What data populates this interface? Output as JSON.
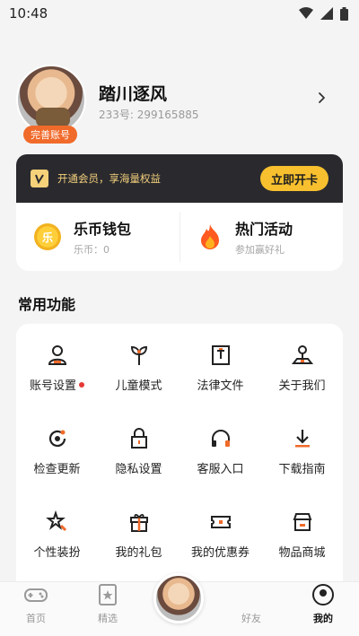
{
  "status_bar": {
    "time": "10:48"
  },
  "profile": {
    "name": "踏川逐风",
    "id_text": "233号: 299165885",
    "badge": "完善账号"
  },
  "vip": {
    "text": "开通会员，享海量权益",
    "button": "立即开卡"
  },
  "wallet": {
    "title": "乐币钱包",
    "sub": "乐币：0",
    "icon_text": "乐"
  },
  "events": {
    "title": "热门活动",
    "sub": "参加赢好礼"
  },
  "functions": {
    "title": "常用功能",
    "items": [
      {
        "label": "账号设置",
        "icon": "user-settings-icon"
      },
      {
        "label": "儿童模式",
        "icon": "sprout-icon"
      },
      {
        "label": "法律文件",
        "icon": "document-icon"
      },
      {
        "label": "关于我们",
        "icon": "about-icon"
      },
      {
        "label": "检查更新",
        "icon": "refresh-icon"
      },
      {
        "label": "隐私设置",
        "icon": "lock-icon"
      },
      {
        "label": "客服入口",
        "icon": "headset-icon"
      },
      {
        "label": "下载指南",
        "icon": "download-icon"
      },
      {
        "label": "个性装扮",
        "icon": "star-icon"
      },
      {
        "label": "我的礼包",
        "icon": "gift-icon"
      },
      {
        "label": "我的优惠券",
        "icon": "coupon-icon"
      },
      {
        "label": "物品商城",
        "icon": "shop-icon"
      }
    ]
  },
  "tabs": {
    "home": "首页",
    "featured": "精选",
    "friends": "好友",
    "me": "我的"
  },
  "colors": {
    "accent": "#f8c02e",
    "badge": "#f06a2a",
    "vip_bg": "#2a2a2e"
  }
}
